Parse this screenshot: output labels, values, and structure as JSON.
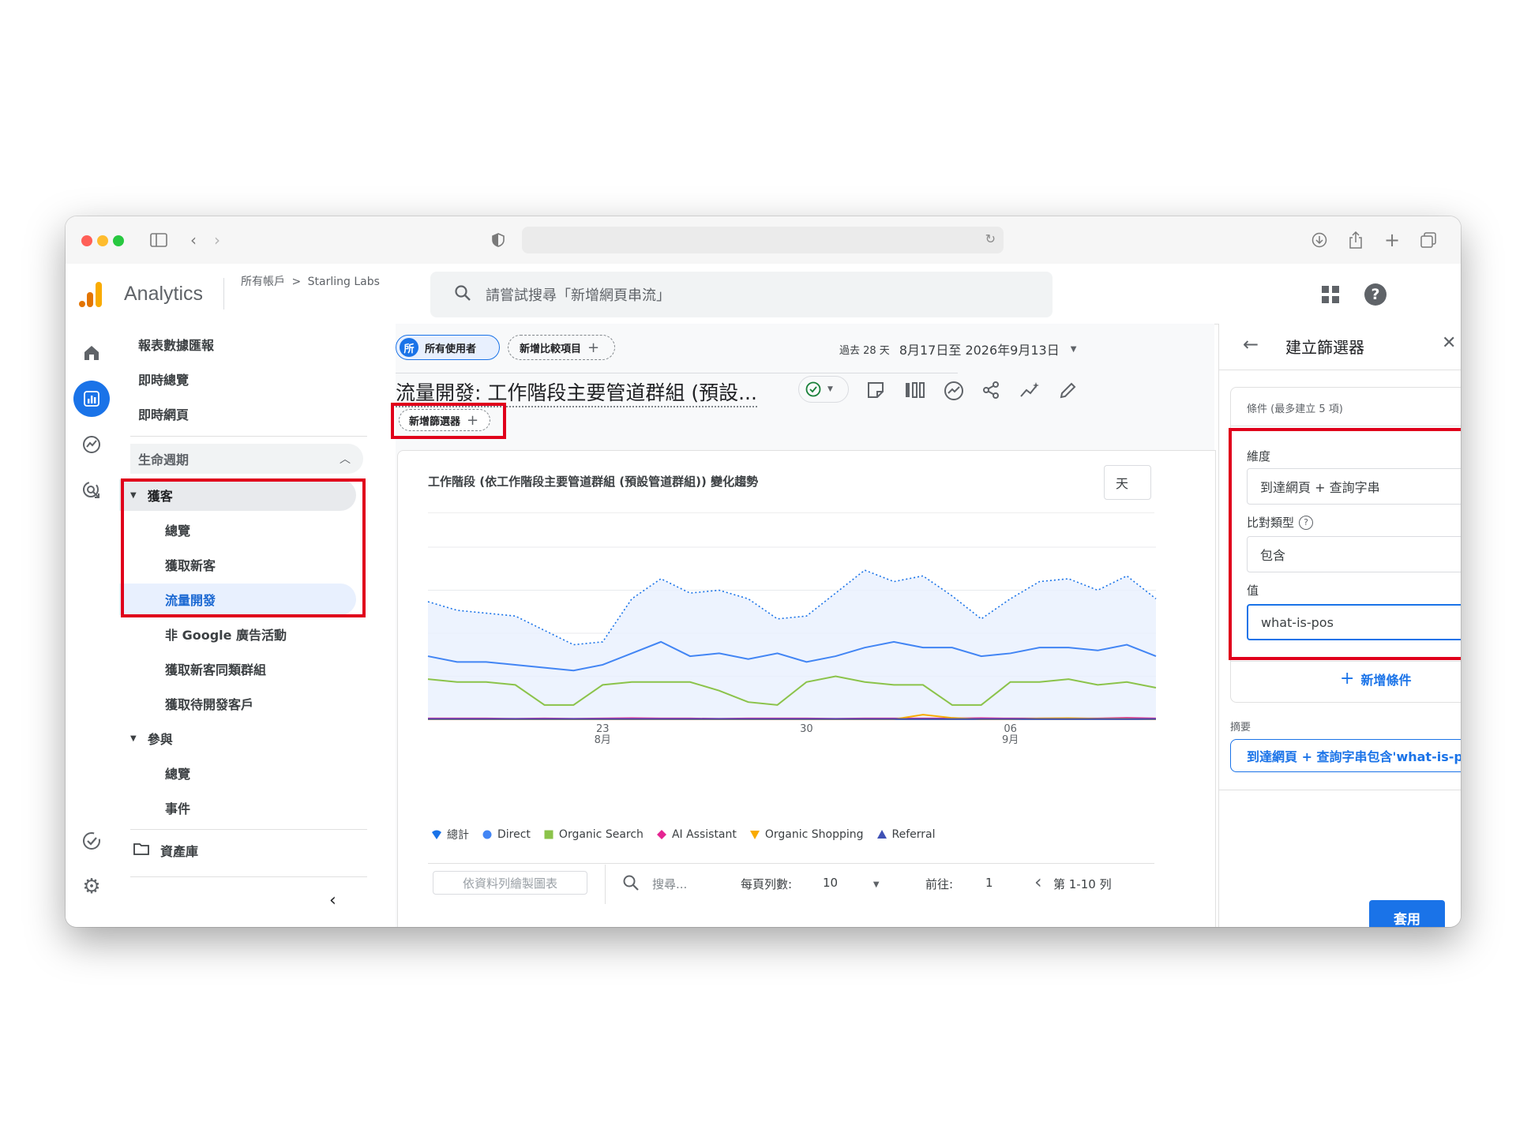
{
  "browser": {
    "colors": {
      "close": "#ff5f57",
      "minimize": "#febc2e",
      "maximize": "#28c840"
    }
  },
  "app": {
    "name": "Analytics",
    "breadcrumb": {
      "account": "所有帳戶",
      "separator": ">",
      "property": "Starling Labs"
    },
    "search_placeholder": "請嘗試搜尋「新增網頁串流」"
  },
  "nav": {
    "reports_snapshot": "報表數據匯報",
    "realtime_overview": "即時總覽",
    "realtime_pages": "即時網頁",
    "lifecycle": "生命週期",
    "acquisition": "獲客",
    "acq_overview": "總覽",
    "user_acquisition": "獲取新客",
    "traffic_acquisition": "流量開發",
    "non_google_campaigns": "非 Google 廣告活動",
    "user_acq_cohort": "獲取新客同類群組",
    "lead_acquisition": "獲取待開發客戶",
    "engagement": "參與",
    "eng_overview": "總覽",
    "events": "事件",
    "library": "資產庫"
  },
  "report": {
    "segment_chip_icon": "所",
    "segment_chip": "所有使用者",
    "add_comparison": "新增比較項目",
    "date_prefix": "過去 28 天",
    "date_range": "8月17日至 2026年9月13日",
    "title": "流量開發: 工作階段主要管道群組 (預設...",
    "add_filter": "新增篩選器",
    "chart_title": "工作階段 (依工作階段主要管道群組 (預設管道群組)) 變化趨勢",
    "chart_period": "天",
    "table_toolbar": {
      "plot_rows": "依資料列繪製圖表",
      "search_placeholder": "搜尋...",
      "rows_per_page_label": "每頁列數:",
      "rows_per_page": "10",
      "goto_label": "前往:",
      "goto_value": "1",
      "range": "第 1-10 列"
    }
  },
  "chart_data": {
    "type": "line",
    "x_ticks": [
      {
        "day": "23",
        "month": "8月"
      },
      {
        "day": "30",
        "month": ""
      },
      {
        "day": "06",
        "month": "9月"
      }
    ],
    "series": [
      {
        "name": "總計",
        "color": "#1a73e8",
        "style": "dotted-area",
        "values": [
          41,
          38,
          37,
          36,
          31,
          26,
          27,
          42,
          49,
          44,
          45,
          42,
          35,
          36,
          44,
          52,
          48,
          50,
          43,
          35,
          42,
          48,
          49,
          45,
          50,
          42
        ]
      },
      {
        "name": "Direct",
        "color": "#4285f4",
        "style": "line",
        "values": [
          22,
          20,
          20,
          19,
          18,
          17,
          19,
          23,
          27,
          22,
          23,
          21,
          23,
          20,
          22,
          25,
          27,
          25,
          25,
          22,
          23,
          25,
          25,
          24,
          26,
          22
        ]
      },
      {
        "name": "Organic Search",
        "color": "#8bc34a",
        "style": "line",
        "values": [
          14,
          13,
          13,
          12,
          5,
          5,
          12,
          13,
          13,
          13,
          10,
          6,
          5,
          13,
          15,
          13,
          12,
          12,
          5,
          5,
          13,
          13,
          14,
          12,
          13,
          11
        ]
      },
      {
        "name": "AI Assistant",
        "color": "#e52592",
        "style": "line",
        "values": [
          0.3,
          0.3,
          0.3,
          0.2,
          0.3,
          0.2,
          0.3,
          0.4,
          0.3,
          0.3,
          0.2,
          0.3,
          0.3,
          0.3,
          0.2,
          0.3,
          0.3,
          0.3,
          0.3,
          0.4,
          0.3,
          0.3,
          0.3,
          0.3,
          0.5,
          0.3
        ]
      },
      {
        "name": "Organic Shopping",
        "color": "#f9ab00",
        "style": "line",
        "values": [
          0,
          0,
          0,
          0,
          0,
          0,
          0,
          0,
          0,
          0,
          0,
          0,
          0,
          0,
          0,
          0,
          0,
          1.6,
          0.5,
          0,
          0,
          0.3,
          0.4,
          0.2,
          0.2,
          0
        ]
      },
      {
        "name": "Referral",
        "color": "#3f51b5",
        "style": "line",
        "values": [
          0.1,
          0.1,
          0.1,
          0.1,
          0.1,
          0.1,
          0.1,
          0.1,
          0.1,
          0.1,
          0.1,
          0.1,
          0.1,
          0.1,
          0.1,
          0.1,
          0.1,
          0.1,
          0.1,
          0.1,
          0.1,
          0.1,
          0.1,
          0.1,
          0.1,
          0.1
        ]
      }
    ]
  },
  "filter_panel": {
    "title": "建立篩選器",
    "conditions_label": "條件 (最多建立 5 項)",
    "dimension_label": "維度",
    "dimension_value": "到達網頁 + 查詢字串",
    "match_type_label": "比對類型",
    "match_type_value": "包含",
    "value_label": "值",
    "value_input": "what-is-pos",
    "add_condition": "新增條件",
    "summary_label": "摘要",
    "summary_value": "到達網頁 + 查詢字串包含'what-is-pos'",
    "apply": "套用"
  }
}
